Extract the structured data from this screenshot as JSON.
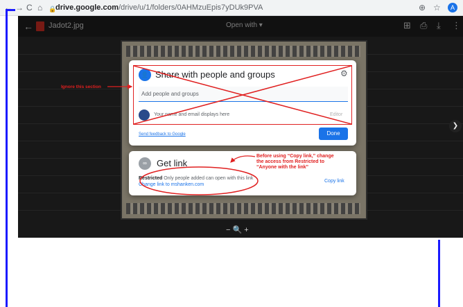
{
  "browser": {
    "back_icon": "back-arrow-icon",
    "url_host": "drive.google.com",
    "url_path": "/drive/u/1/folders/0AHMzuEpis7yDUk9PVA",
    "profile_initial": "A"
  },
  "viewer": {
    "file_name": "Jadot2.jpg",
    "open_with": "Open with ▾"
  },
  "share_dialog": {
    "title": "Share with people and groups",
    "input_placeholder": "Add people and groups",
    "owner_text": "Your name and email displays here",
    "owner_role": "Editor",
    "feedback_link": "Send feedback to Google",
    "done_label": "Done"
  },
  "get_link_dialog": {
    "title": "Get link",
    "restricted_label": "Restricted",
    "restricted_desc": "Only people added can open with this link",
    "change_link": "Change link to mshanken.com",
    "copy_label": "Copy link"
  },
  "zoom_controls": "−   🔍   +",
  "annotations": {
    "ignore": "Ignore this section",
    "before_using": [
      "Before using “Copy link,” change",
      "the access from Restricted to",
      "“Anyone with the link”"
    ]
  },
  "colors": {
    "accent": "#1a73e8",
    "annotation": "#e02020",
    "frame": "#1a1aff"
  }
}
